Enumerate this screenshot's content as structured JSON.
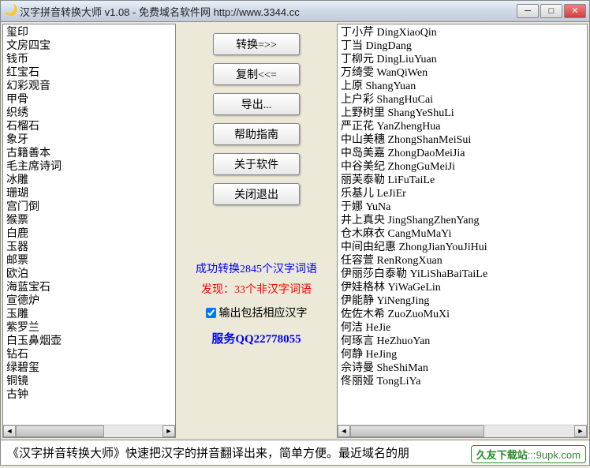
{
  "window": {
    "title": "汉字拼音转换大师 v1.08 - 免费域名软件网 http://www.3344.cc"
  },
  "left_items": [
    "玺印",
    "文房四宝",
    "钱币",
    "红宝石",
    "幻彩观音",
    "甲骨",
    "织绣",
    "石榴石",
    "象牙",
    "古籍善本",
    "毛主席诗词",
    "冰雕",
    "珊瑚",
    "宫门倒",
    "猴票",
    "白鹿",
    "玉器",
    "邮票",
    "欧泊",
    "海蓝宝石",
    "宣德炉",
    "玉雕",
    "紫罗兰",
    "白玉鼻烟壶",
    "钻石",
    "绿碧玺",
    "铜镜",
    "古钟"
  ],
  "right_items": [
    "丁小芹 DingXiaoQin",
    "丁当 DingDang",
    "丁柳元 DingLiuYuan",
    "万绮雯 WanQiWen",
    "上原 ShangYuan",
    "上户彩 ShangHuCai",
    "上野树里 ShangYeShuLi",
    "严正花 YanZhengHua",
    "中山美穗 ZhongShanMeiSui",
    "中岛美嘉 ZhongDaoMeiJia",
    "中谷美纪 ZhongGuMeiJi",
    "丽芙泰勒 LiFuTaiLe",
    "乐基儿 LeJiEr",
    "于娜 YuNa",
    "井上真央 JingShangZhenYang",
    "仓木麻衣 CangMuMaYi",
    "中间由纪惠 ZhongJianYouJiHui",
    "任容萱 RenRongXuan",
    "伊丽莎白泰勒 YiLiShaBaiTaiLe",
    "伊娃格林 YiWaGeLin",
    "伊能静 YiNengJing",
    "佐佐木希 ZuoZuoMuXi",
    "何洁 HeJie",
    "何琢言 HeZhuoYan",
    "何静 HeJing",
    "佘诗曼 SheShiMan",
    "佟丽娅 TongLiYa"
  ],
  "buttons": {
    "convert": "转换=>>",
    "copy": "复制<<=",
    "export": "导出...",
    "help": "帮助指南",
    "about": "关于软件",
    "exit": "关闭退出"
  },
  "status": {
    "success": "成功转换2845个汉字词语",
    "found": "发现：33个非汉字词语",
    "checkbox_label": "输出包括相应汉字",
    "checkbox_checked": true,
    "qq": "服务QQ22778055"
  },
  "footer": {
    "text": "《汉字拼音转换大师》快速把汉字的拼音翻译出来，简单方便。最近域名的朋",
    "watermark_prefix": "久友下载站",
    "watermark_dots": ":::",
    "watermark_url": "9upk.com"
  }
}
